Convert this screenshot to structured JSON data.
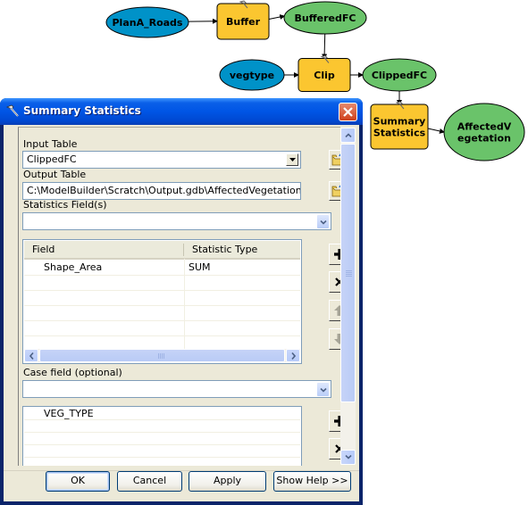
{
  "diagram": {
    "nodes": [
      {
        "id": "plana_roads",
        "type": "input-data",
        "label": [
          "PlanA_Roads"
        ],
        "color": "#0092c8"
      },
      {
        "id": "buffer",
        "type": "tool",
        "label": [
          "Buffer"
        ],
        "color": "#fbc630"
      },
      {
        "id": "bufferedfc",
        "type": "derived-data",
        "label": [
          "BufferedFC"
        ],
        "color": "#6ac36a"
      },
      {
        "id": "vegtype",
        "type": "input-data",
        "label": [
          "vegtype"
        ],
        "color": "#0092c8"
      },
      {
        "id": "clip",
        "type": "tool",
        "label": [
          "Clip"
        ],
        "color": "#fbc630"
      },
      {
        "id": "clippedfc",
        "type": "derived-data",
        "label": [
          "ClippedFC"
        ],
        "color": "#6ac36a"
      },
      {
        "id": "summary_statistics",
        "type": "tool",
        "label": [
          "Summary",
          "Statistics"
        ],
        "color": "#fbc630"
      },
      {
        "id": "affectedvegetation",
        "type": "derived-data",
        "label": [
          "AffectedV",
          "egetation"
        ],
        "color": "#6ac36a"
      }
    ],
    "edges": [
      [
        "plana_roads",
        "buffer"
      ],
      [
        "buffer",
        "bufferedfc"
      ],
      [
        "bufferedfc",
        "clip"
      ],
      [
        "vegtype",
        "clip"
      ],
      [
        "clip",
        "clippedfc"
      ],
      [
        "clippedfc",
        "summary_statistics"
      ],
      [
        "summary_statistics",
        "affectedvegetation"
      ]
    ]
  },
  "dialog": {
    "title": "Summary Statistics",
    "title_icon": "hammer-icon",
    "input_table": {
      "label": "Input Table",
      "value": "ClippedFC"
    },
    "output_table": {
      "label": "Output Table",
      "value": "C:\\ModelBuilder\\Scratch\\Output.gdb\\AffectedVegetation"
    },
    "statistics_fields": {
      "label": "Statistics Field(s)",
      "value": "",
      "columns": [
        "Field",
        "Statistic Type"
      ],
      "rows": [
        {
          "field": "Shape_Area",
          "statistic": "SUM"
        }
      ]
    },
    "case_field": {
      "label": "Case field (optional)",
      "value": "",
      "rows": [
        "VEG_TYPE"
      ]
    },
    "buttons": {
      "ok": "OK",
      "cancel": "Cancel",
      "apply": "Apply",
      "show_help": "Show Help >>"
    }
  }
}
